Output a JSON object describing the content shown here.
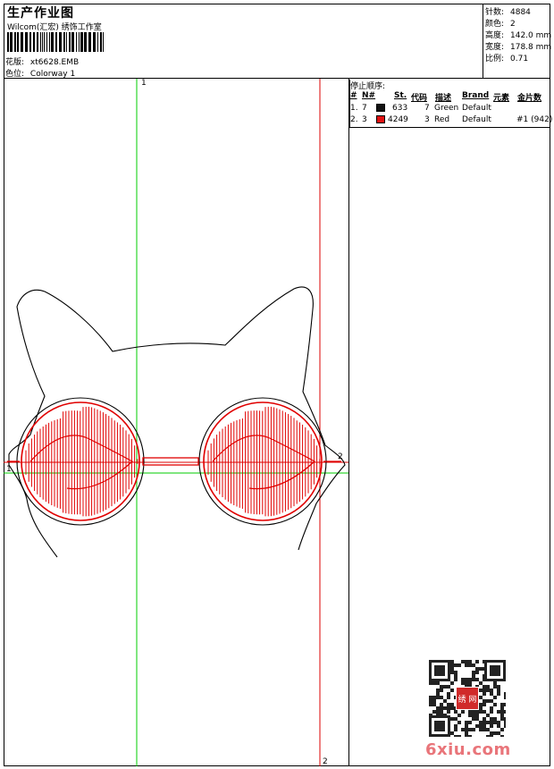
{
  "header": {
    "title": "生产作业图",
    "company": "Wilcom(汇宏) 绣饰工作室",
    "design_label": "花版:",
    "design_file": "xt6628.EMB",
    "colorway_label": "色位:",
    "colorway": "Colorway 1"
  },
  "stats": [
    {
      "label": "针数:",
      "value": "4884"
    },
    {
      "label": "颜色:",
      "value": "2"
    },
    {
      "label": "高度:",
      "value": "142.0 mm"
    },
    {
      "label": "宽度:",
      "value": "178.8 mm"
    },
    {
      "label": "比例:",
      "value": "0.71"
    }
  ],
  "stop_sequence": {
    "title": "停止顺序:",
    "headers": [
      "#",
      "N#",
      "St.",
      "代码",
      "描述",
      "Brand",
      "元素",
      "金片数"
    ],
    "rows": [
      {
        "num": "1.",
        "needle": "7",
        "color": "#111111",
        "stitches": "633",
        "code": "7",
        "desc": "Green",
        "brand": "Default",
        "element": "",
        "sequins": ""
      },
      {
        "num": "2.",
        "needle": "3",
        "color": "#e01010",
        "stitches": "4249",
        "code": "3",
        "desc": "Red",
        "brand": "Default",
        "element": "",
        "sequins": "#1 (942)"
      }
    ]
  },
  "guides": {
    "v1": "1",
    "v2": "2",
    "h1_left": "1",
    "h2_right": "2",
    "guide_green": "#00cc00",
    "guide_red": "#dd0000"
  },
  "design": {
    "outline_color": "#000000",
    "stitch_color": "#e00000"
  },
  "watermark": {
    "text": "6xiu.com",
    "seal": "绣 网"
  }
}
